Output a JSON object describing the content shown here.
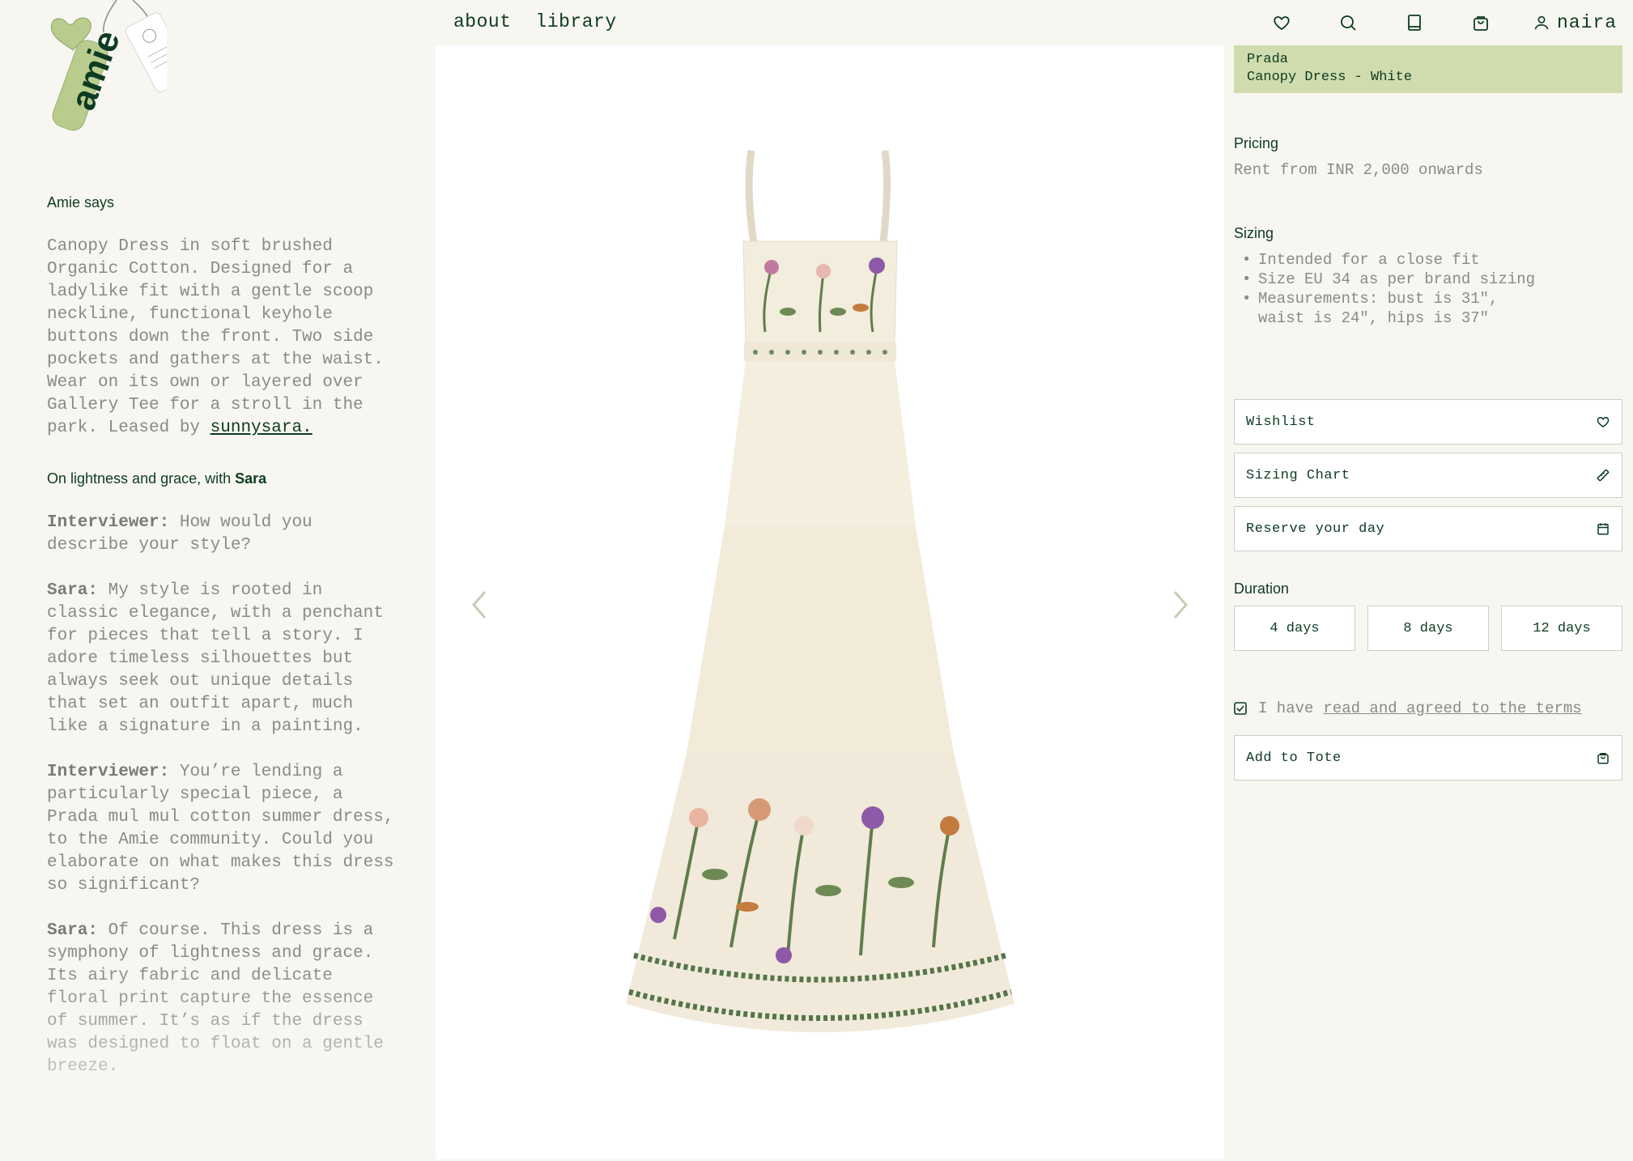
{
  "brand": {
    "logo_text": "amie"
  },
  "nav": {
    "links": [
      "about",
      "library"
    ],
    "icons": [
      "heart-icon",
      "search-icon",
      "book-icon",
      "bag-icon"
    ],
    "user_name": "naira"
  },
  "left": {
    "amie_says_label": "Amie says",
    "description_text": "Canopy Dress in soft brushed Organic Cotton. Designed for a ladylike fit  with a gentle scoop neckline, functional keyhole buttons down the front. Two side pockets and gathers at the waist. Wear on its own or layered over Gallery Tee for a stroll in the park. Leased by ",
    "leased_by_link": "sunnysara.",
    "interview_label_prefix": "On lightness and grace, with ",
    "interview_label_name": "Sara",
    "qa": [
      {
        "who": "Interviewer:",
        "text": " How would you describe your style?"
      },
      {
        "who": "Sara:",
        "text": " My style is rooted in classic elegance, with a penchant for pieces that tell a story. I adore timeless silhouettes but always seek out unique details that set an outfit apart, much like a signature in a painting."
      },
      {
        "who": "Interviewer:",
        "text": " You’re lending a particularly special piece, a Prada mul mul cotton summer dress, to the Amie community. Could you elaborate on what makes this dress so significant?"
      },
      {
        "who": "Sara:",
        "text": " Of course. This dress is a symphony of lightness and grace. Its airy fabric and delicate floral print capture the essence of summer. It’s as if the dress was designed to float on a gentle breeze."
      }
    ]
  },
  "product": {
    "brand": "Prada",
    "name": "Canopy Dress - White",
    "pricing_label": "Pricing",
    "pricing_text": "Rent from INR 2,000 onwards",
    "sizing_label": "Sizing",
    "sizing_items": [
      "Intended for a close fit",
      "Size EU 34 as per brand sizing",
      "Measurements: bust is 31\",",
      "waist is 24\", hips is 37\""
    ]
  },
  "actions": {
    "wishlist": "Wishlist",
    "sizing_chart": "Sizing Chart",
    "reserve": "Reserve your day",
    "duration_label": "Duration",
    "durations": [
      "4 days",
      "8 days",
      "12 days"
    ],
    "terms_prefix": "I have",
    "terms_link": "read and agreed to the terms",
    "add_to_tote": "Add to Tote"
  },
  "colors": {
    "primary_green": "#0c3b22",
    "banner_green": "#d0dcae",
    "background": "#f7f6f1",
    "muted_text": "#8a8a8a"
  }
}
